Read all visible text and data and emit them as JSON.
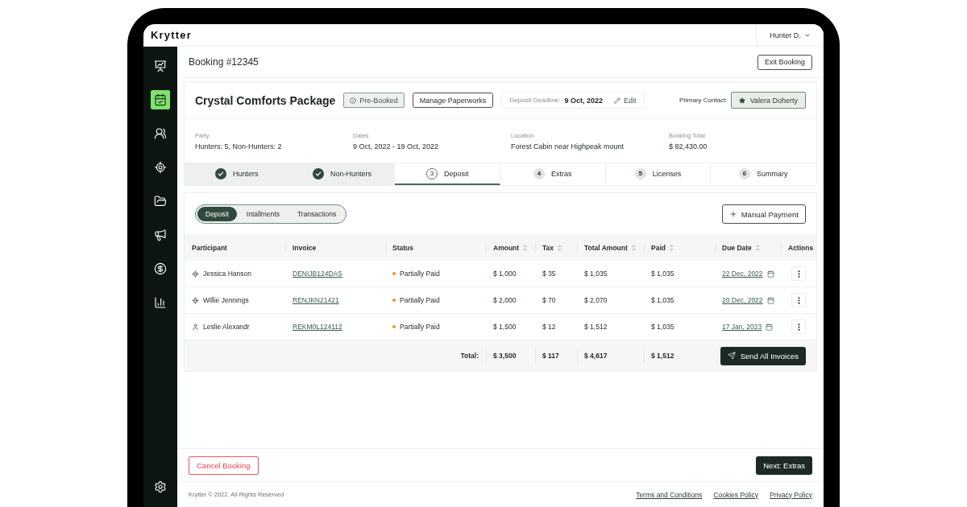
{
  "app": {
    "logo": "Krytter",
    "user": "Hunter D."
  },
  "sidebar": {
    "items": [
      {
        "selected": false
      },
      {
        "selected": true
      },
      {
        "selected": false
      },
      {
        "selected": false
      },
      {
        "selected": false
      },
      {
        "selected": false
      },
      {
        "selected": false
      },
      {
        "selected": false
      }
    ],
    "footer_items": [
      {
        "selected": false
      }
    ]
  },
  "page": {
    "title": "Booking #12345",
    "exit_button": "Exit Booking"
  },
  "booking": {
    "title": "Crystal Comforts Package",
    "status": "Pre-Booked",
    "paperwork_button": "Manage Paperworks",
    "deadline": {
      "label": "Deposit Deadline:",
      "value": "9 Oct, 2022",
      "edit": "Edit"
    },
    "contact": {
      "label": "Primary Contact:",
      "name": "Valera Doherty"
    },
    "details": [
      {
        "label": "Party",
        "value": "Hunters: 5, Non-Hunters: 2"
      },
      {
        "label": "Dates",
        "value": "9 Oct, 2022 - 19 Oct, 2022"
      },
      {
        "label": "Location",
        "value": "Forest Cabin near Highpeak mount"
      },
      {
        "label": "Booking Total",
        "value": "$ 82,430.00"
      }
    ]
  },
  "steps": [
    {
      "label": "Hunters",
      "done": true,
      "selected": false
    },
    {
      "label": "Non-Hunters",
      "done": true,
      "selected": false
    },
    {
      "number": "3",
      "label": "Deposit",
      "done": false,
      "selected": true
    },
    {
      "number": "4",
      "label": "Extras",
      "done": false,
      "selected": false
    },
    {
      "number": "5",
      "label": "Licenses",
      "done": false,
      "selected": false
    },
    {
      "number": "6",
      "label": "Summary",
      "done": false,
      "selected": false
    }
  ],
  "payments": {
    "tabs": [
      {
        "label": "Deposit",
        "selected": true
      },
      {
        "label": "Intallments",
        "selected": false
      },
      {
        "label": "Transactions",
        "selected": false
      }
    ],
    "manual_button": "Manual Payment",
    "columns": [
      {
        "label": "Participant",
        "sortable": false
      },
      {
        "label": "Invoice",
        "sortable": false
      },
      {
        "label": "Status",
        "sortable": false
      },
      {
        "label": "Amount",
        "sortable": true
      },
      {
        "label": "Tax",
        "sortable": true
      },
      {
        "label": "Total Amount",
        "sortable": true
      },
      {
        "label": "Paid",
        "sortable": true
      },
      {
        "label": "Due Date",
        "sortable": true
      },
      {
        "label": "Actions",
        "sortable": false
      }
    ],
    "rows": [
      {
        "participant": "Jessica Hanson",
        "kind": "hunter",
        "invoice": "DENIJB124DAS",
        "status": {
          "label": "Partially Paid",
          "color": "#f5902c"
        },
        "amount": "$ 1,000",
        "tax": "$ 35",
        "total": "$ 1,035",
        "paid": "$ 1,035",
        "due_date": "22 Dec, 2022"
      },
      {
        "participant": "Willie Jennings",
        "kind": "hunter",
        "invoice": "RENJKN21421",
        "status": {
          "label": "Partially Paid",
          "color": "#f5902c"
        },
        "amount": "$ 2,000",
        "tax": "$ 70",
        "total": "$ 2,070",
        "paid": "$ 1,035",
        "due_date": "20 Dec, 2022"
      },
      {
        "participant": "Leslie Alexandr",
        "kind": "non_hunter",
        "invoice": "REKM0L124112",
        "status": {
          "label": "Partially Paid",
          "color": "#f5902c"
        },
        "amount": "$ 1,500",
        "tax": "$ 12",
        "total": "$ 1,512",
        "paid": "$ 1,035",
        "due_date": "17 Jan, 2023"
      }
    ],
    "totals": {
      "label": "Total:",
      "amount": "$ 3,500",
      "tax": "$ 117",
      "total": "$ 4,617",
      "paid": "$ 1,512"
    },
    "send_button": "Send All Invoices"
  },
  "actions": {
    "cancel": "Cancel Booking",
    "next": "Next: Extras"
  },
  "footer": {
    "copyright": "Krytter © 2022. All Rights Reserved",
    "links": [
      "Terms and Conditions",
      "Cookies Policy",
      "Privacy Policy"
    ]
  }
}
